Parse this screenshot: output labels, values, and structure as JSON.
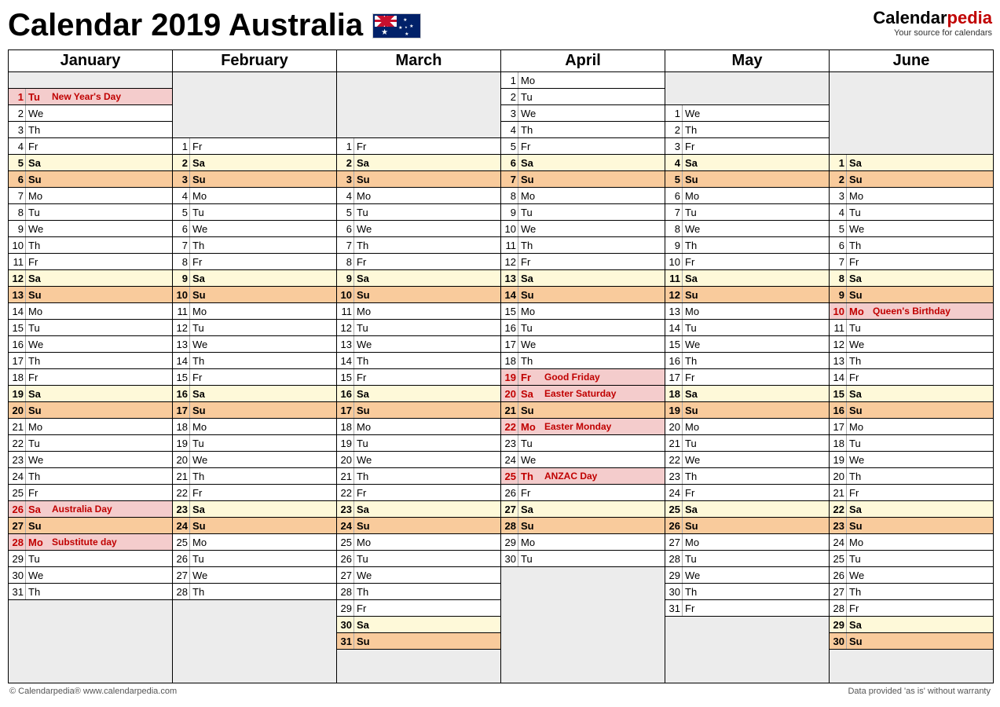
{
  "title": "Calendar 2019 Australia",
  "logo": {
    "main": "Calendarpedia",
    "sub": "Your source for calendars"
  },
  "footer": {
    "copyright": "© Calendarpedia®   www.calendarpedia.com",
    "disclaimer": "Data provided 'as is' without warranty"
  },
  "months": [
    "January",
    "February",
    "March",
    "April",
    "May",
    "June"
  ],
  "totalRows": 37,
  "columns": [
    {
      "startRow": 1,
      "days": [
        {
          "n": 1,
          "d": "Tu",
          "hol": "New Year's Day"
        },
        {
          "n": 2,
          "d": "We"
        },
        {
          "n": 3,
          "d": "Th"
        },
        {
          "n": 4,
          "d": "Fr"
        },
        {
          "n": 5,
          "d": "Sa",
          "sat": true
        },
        {
          "n": 6,
          "d": "Su",
          "sun": true
        },
        {
          "n": 7,
          "d": "Mo"
        },
        {
          "n": 8,
          "d": "Tu"
        },
        {
          "n": 9,
          "d": "We"
        },
        {
          "n": 10,
          "d": "Th"
        },
        {
          "n": 11,
          "d": "Fr"
        },
        {
          "n": 12,
          "d": "Sa",
          "sat": true
        },
        {
          "n": 13,
          "d": "Su",
          "sun": true
        },
        {
          "n": 14,
          "d": "Mo"
        },
        {
          "n": 15,
          "d": "Tu"
        },
        {
          "n": 16,
          "d": "We"
        },
        {
          "n": 17,
          "d": "Th"
        },
        {
          "n": 18,
          "d": "Fr"
        },
        {
          "n": 19,
          "d": "Sa",
          "sat": true
        },
        {
          "n": 20,
          "d": "Su",
          "sun": true
        },
        {
          "n": 21,
          "d": "Mo"
        },
        {
          "n": 22,
          "d": "Tu"
        },
        {
          "n": 23,
          "d": "We"
        },
        {
          "n": 24,
          "d": "Th"
        },
        {
          "n": 25,
          "d": "Fr"
        },
        {
          "n": 26,
          "d": "Sa",
          "hol": "Australia Day"
        },
        {
          "n": 27,
          "d": "Su",
          "sun": true
        },
        {
          "n": 28,
          "d": "Mo",
          "hol": "Substitute day"
        },
        {
          "n": 29,
          "d": "Tu"
        },
        {
          "n": 30,
          "d": "We"
        },
        {
          "n": 31,
          "d": "Th"
        }
      ]
    },
    {
      "startRow": 4,
      "days": [
        {
          "n": 1,
          "d": "Fr"
        },
        {
          "n": 2,
          "d": "Sa",
          "sat": true
        },
        {
          "n": 3,
          "d": "Su",
          "sun": true
        },
        {
          "n": 4,
          "d": "Mo"
        },
        {
          "n": 5,
          "d": "Tu"
        },
        {
          "n": 6,
          "d": "We"
        },
        {
          "n": 7,
          "d": "Th"
        },
        {
          "n": 8,
          "d": "Fr"
        },
        {
          "n": 9,
          "d": "Sa",
          "sat": true
        },
        {
          "n": 10,
          "d": "Su",
          "sun": true
        },
        {
          "n": 11,
          "d": "Mo"
        },
        {
          "n": 12,
          "d": "Tu"
        },
        {
          "n": 13,
          "d": "We"
        },
        {
          "n": 14,
          "d": "Th"
        },
        {
          "n": 15,
          "d": "Fr"
        },
        {
          "n": 16,
          "d": "Sa",
          "sat": true
        },
        {
          "n": 17,
          "d": "Su",
          "sun": true
        },
        {
          "n": 18,
          "d": "Mo"
        },
        {
          "n": 19,
          "d": "Tu"
        },
        {
          "n": 20,
          "d": "We"
        },
        {
          "n": 21,
          "d": "Th"
        },
        {
          "n": 22,
          "d": "Fr"
        },
        {
          "n": 23,
          "d": "Sa",
          "sat": true
        },
        {
          "n": 24,
          "d": "Su",
          "sun": true
        },
        {
          "n": 25,
          "d": "Mo"
        },
        {
          "n": 26,
          "d": "Tu"
        },
        {
          "n": 27,
          "d": "We"
        },
        {
          "n": 28,
          "d": "Th"
        }
      ]
    },
    {
      "startRow": 4,
      "days": [
        {
          "n": 1,
          "d": "Fr"
        },
        {
          "n": 2,
          "d": "Sa",
          "sat": true
        },
        {
          "n": 3,
          "d": "Su",
          "sun": true
        },
        {
          "n": 4,
          "d": "Mo"
        },
        {
          "n": 5,
          "d": "Tu"
        },
        {
          "n": 6,
          "d": "We"
        },
        {
          "n": 7,
          "d": "Th"
        },
        {
          "n": 8,
          "d": "Fr"
        },
        {
          "n": 9,
          "d": "Sa",
          "sat": true
        },
        {
          "n": 10,
          "d": "Su",
          "sun": true
        },
        {
          "n": 11,
          "d": "Mo"
        },
        {
          "n": 12,
          "d": "Tu"
        },
        {
          "n": 13,
          "d": "We"
        },
        {
          "n": 14,
          "d": "Th"
        },
        {
          "n": 15,
          "d": "Fr"
        },
        {
          "n": 16,
          "d": "Sa",
          "sat": true
        },
        {
          "n": 17,
          "d": "Su",
          "sun": true
        },
        {
          "n": 18,
          "d": "Mo"
        },
        {
          "n": 19,
          "d": "Tu"
        },
        {
          "n": 20,
          "d": "We"
        },
        {
          "n": 21,
          "d": "Th"
        },
        {
          "n": 22,
          "d": "Fr"
        },
        {
          "n": 23,
          "d": "Sa",
          "sat": true
        },
        {
          "n": 24,
          "d": "Su",
          "sun": true
        },
        {
          "n": 25,
          "d": "Mo"
        },
        {
          "n": 26,
          "d": "Tu"
        },
        {
          "n": 27,
          "d": "We"
        },
        {
          "n": 28,
          "d": "Th"
        },
        {
          "n": 29,
          "d": "Fr"
        },
        {
          "n": 30,
          "d": "Sa",
          "sat": true
        },
        {
          "n": 31,
          "d": "Su",
          "sun": true
        }
      ]
    },
    {
      "startRow": 0,
      "days": [
        {
          "n": 1,
          "d": "Mo"
        },
        {
          "n": 2,
          "d": "Tu"
        },
        {
          "n": 3,
          "d": "We"
        },
        {
          "n": 4,
          "d": "Th"
        },
        {
          "n": 5,
          "d": "Fr"
        },
        {
          "n": 6,
          "d": "Sa",
          "sat": true
        },
        {
          "n": 7,
          "d": "Su",
          "sun": true
        },
        {
          "n": 8,
          "d": "Mo"
        },
        {
          "n": 9,
          "d": "Tu"
        },
        {
          "n": 10,
          "d": "We"
        },
        {
          "n": 11,
          "d": "Th"
        },
        {
          "n": 12,
          "d": "Fr"
        },
        {
          "n": 13,
          "d": "Sa",
          "sat": true
        },
        {
          "n": 14,
          "d": "Su",
          "sun": true
        },
        {
          "n": 15,
          "d": "Mo"
        },
        {
          "n": 16,
          "d": "Tu"
        },
        {
          "n": 17,
          "d": "We"
        },
        {
          "n": 18,
          "d": "Th"
        },
        {
          "n": 19,
          "d": "Fr",
          "hol": "Good Friday"
        },
        {
          "n": 20,
          "d": "Sa",
          "hol": "Easter Saturday"
        },
        {
          "n": 21,
          "d": "Su",
          "sun": true
        },
        {
          "n": 22,
          "d": "Mo",
          "hol": "Easter Monday"
        },
        {
          "n": 23,
          "d": "Tu"
        },
        {
          "n": 24,
          "d": "We"
        },
        {
          "n": 25,
          "d": "Th",
          "hol": "ANZAC Day"
        },
        {
          "n": 26,
          "d": "Fr"
        },
        {
          "n": 27,
          "d": "Sa",
          "sat": true
        },
        {
          "n": 28,
          "d": "Su",
          "sun": true
        },
        {
          "n": 29,
          "d": "Mo"
        },
        {
          "n": 30,
          "d": "Tu"
        }
      ]
    },
    {
      "startRow": 2,
      "days": [
        {
          "n": 1,
          "d": "We"
        },
        {
          "n": 2,
          "d": "Th"
        },
        {
          "n": 3,
          "d": "Fr"
        },
        {
          "n": 4,
          "d": "Sa",
          "sat": true
        },
        {
          "n": 5,
          "d": "Su",
          "sun": true
        },
        {
          "n": 6,
          "d": "Mo"
        },
        {
          "n": 7,
          "d": "Tu"
        },
        {
          "n": 8,
          "d": "We"
        },
        {
          "n": 9,
          "d": "Th"
        },
        {
          "n": 10,
          "d": "Fr"
        },
        {
          "n": 11,
          "d": "Sa",
          "sat": true
        },
        {
          "n": 12,
          "d": "Su",
          "sun": true
        },
        {
          "n": 13,
          "d": "Mo"
        },
        {
          "n": 14,
          "d": "Tu"
        },
        {
          "n": 15,
          "d": "We"
        },
        {
          "n": 16,
          "d": "Th"
        },
        {
          "n": 17,
          "d": "Fr"
        },
        {
          "n": 18,
          "d": "Sa",
          "sat": true
        },
        {
          "n": 19,
          "d": "Su",
          "sun": true
        },
        {
          "n": 20,
          "d": "Mo"
        },
        {
          "n": 21,
          "d": "Tu"
        },
        {
          "n": 22,
          "d": "We"
        },
        {
          "n": 23,
          "d": "Th"
        },
        {
          "n": 24,
          "d": "Fr"
        },
        {
          "n": 25,
          "d": "Sa",
          "sat": true
        },
        {
          "n": 26,
          "d": "Su",
          "sun": true
        },
        {
          "n": 27,
          "d": "Mo"
        },
        {
          "n": 28,
          "d": "Tu"
        },
        {
          "n": 29,
          "d": "We"
        },
        {
          "n": 30,
          "d": "Th"
        },
        {
          "n": 31,
          "d": "Fr"
        }
      ]
    },
    {
      "startRow": 5,
      "days": [
        {
          "n": 1,
          "d": "Sa",
          "sat": true
        },
        {
          "n": 2,
          "d": "Su",
          "sun": true
        },
        {
          "n": 3,
          "d": "Mo"
        },
        {
          "n": 4,
          "d": "Tu"
        },
        {
          "n": 5,
          "d": "We"
        },
        {
          "n": 6,
          "d": "Th"
        },
        {
          "n": 7,
          "d": "Fr"
        },
        {
          "n": 8,
          "d": "Sa",
          "sat": true
        },
        {
          "n": 9,
          "d": "Su",
          "sun": true
        },
        {
          "n": 10,
          "d": "Mo",
          "hol": "Queen's Birthday"
        },
        {
          "n": 11,
          "d": "Tu"
        },
        {
          "n": 12,
          "d": "We"
        },
        {
          "n": 13,
          "d": "Th"
        },
        {
          "n": 14,
          "d": "Fr"
        },
        {
          "n": 15,
          "d": "Sa",
          "sat": true
        },
        {
          "n": 16,
          "d": "Su",
          "sun": true
        },
        {
          "n": 17,
          "d": "Mo"
        },
        {
          "n": 18,
          "d": "Tu"
        },
        {
          "n": 19,
          "d": "We"
        },
        {
          "n": 20,
          "d": "Th"
        },
        {
          "n": 21,
          "d": "Fr"
        },
        {
          "n": 22,
          "d": "Sa",
          "sat": true
        },
        {
          "n": 23,
          "d": "Su",
          "sun": true
        },
        {
          "n": 24,
          "d": "Mo"
        },
        {
          "n": 25,
          "d": "Tu"
        },
        {
          "n": 26,
          "d": "We"
        },
        {
          "n": 27,
          "d": "Th"
        },
        {
          "n": 28,
          "d": "Fr"
        },
        {
          "n": 29,
          "d": "Sa",
          "sat": true
        },
        {
          "n": 30,
          "d": "Su",
          "sun": true
        }
      ]
    }
  ]
}
